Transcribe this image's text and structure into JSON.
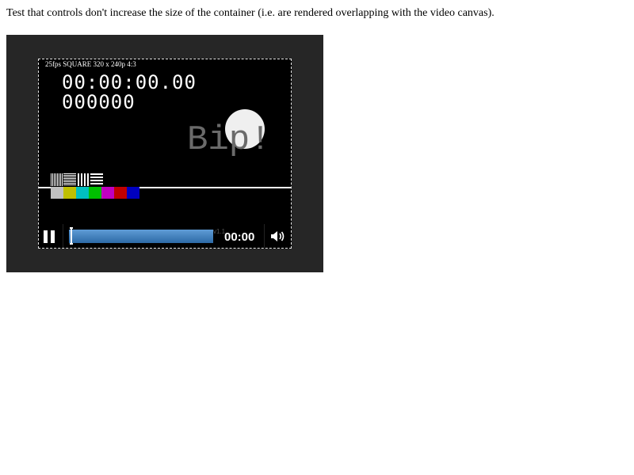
{
  "caption": "Test that controls don't increase the size of the container (i.e. are rendered overlapping with the video canvas).",
  "video": {
    "format_label": "25fps SQUARE 320 x 240p 4:3",
    "timecode": "00:00:00.00",
    "frame_counter": "000000",
    "bip_text": "Bip!",
    "color_bars": [
      "#c0c0c0",
      "#c0c000",
      "#00c0c0",
      "#00c000",
      "#c000c0",
      "#c00000",
      "#0000c0"
    ]
  },
  "controls": {
    "pause_icon": "pause-icon",
    "progress": 0,
    "version_text": "v1.1",
    "time_display": "00:00",
    "volume_icon": "volume-icon"
  },
  "colors": {
    "container_bg": "#262626",
    "seek_bar": "#3d7bbf"
  }
}
